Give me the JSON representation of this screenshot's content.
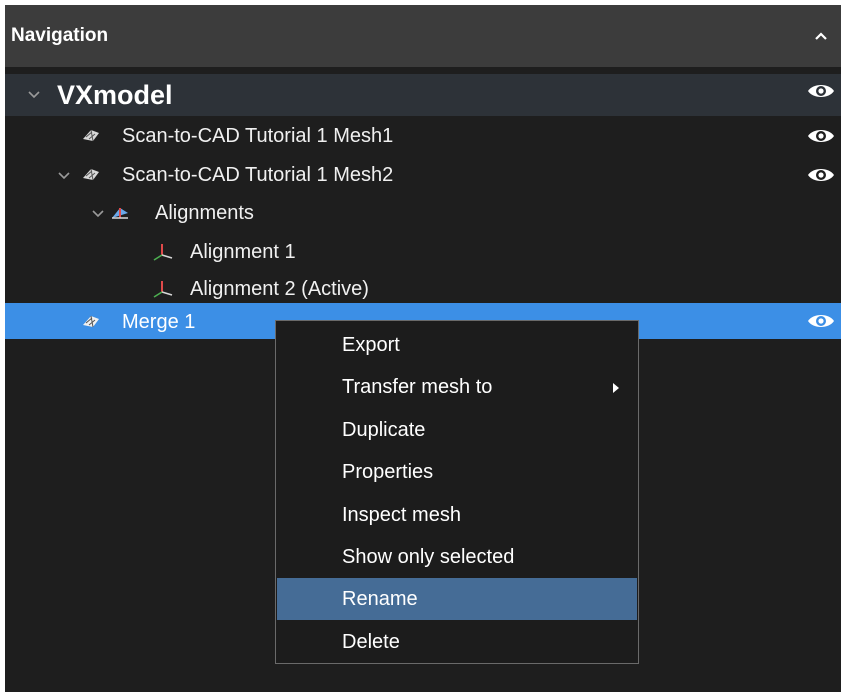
{
  "panel": {
    "title": "Navigation",
    "collapse_icon": "chevron-up-icon"
  },
  "tree": {
    "root": {
      "label": "VXmodel",
      "expanded": true,
      "visible": true
    },
    "mesh1": {
      "label": "Scan-to-CAD Tutorial 1 Mesh1",
      "icon": "mesh-icon",
      "visible": true
    },
    "mesh2": {
      "label": "Scan-to-CAD Tutorial 1 Mesh2",
      "icon": "mesh-icon",
      "expanded": true,
      "visible": true
    },
    "alignments": {
      "label": "Alignments",
      "icon": "alignments-icon",
      "expanded": true
    },
    "alignment1": {
      "label": "Alignment 1",
      "icon": "axes-icon"
    },
    "alignment2": {
      "label": "Alignment 2 (Active)",
      "icon": "axes-icon"
    },
    "merge1": {
      "label": "Merge 1",
      "icon": "mesh-icon",
      "selected": true,
      "visible": true
    }
  },
  "context_menu": {
    "items": [
      {
        "label": "Export"
      },
      {
        "label": "Transfer mesh to",
        "has_submenu": true
      },
      {
        "label": "Duplicate"
      },
      {
        "label": "Properties"
      },
      {
        "label": "Inspect mesh"
      },
      {
        "label": "Show only selected"
      },
      {
        "label": "Rename",
        "highlighted": true
      },
      {
        "label": "Delete"
      }
    ]
  },
  "colors": {
    "panel_bg": "#1e1e1e",
    "header_bg": "#3c3c3c",
    "selection": "#3c8fe6",
    "menu_highlight": "#456c96"
  }
}
